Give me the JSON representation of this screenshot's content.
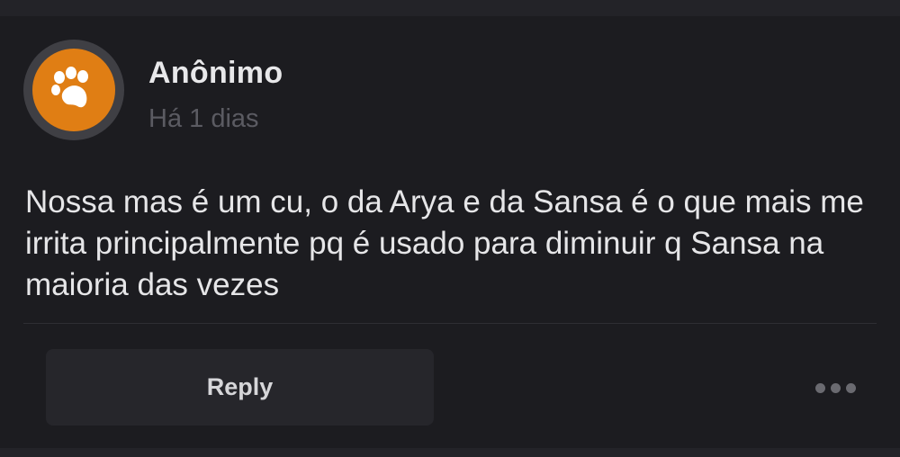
{
  "post": {
    "author": "Anônimo",
    "timestamp": "Há 1 dias",
    "body": "Nossa mas é um cu, o da Arya e da Sansa é o que mais me irrita principalmente pq é usado para diminuir q Sansa na maioria das vezes",
    "avatar_icon": "paw-icon"
  },
  "actions": {
    "reply_label": "Reply",
    "more_icon": "more-dots-icon"
  },
  "colors": {
    "background": "#1c1c20",
    "avatar_bg": "#e07e14",
    "avatar_ring": "#3f3f44",
    "text_primary": "#e6e6e8",
    "text_muted": "#5b5b62",
    "button_bg": "#26262b"
  }
}
